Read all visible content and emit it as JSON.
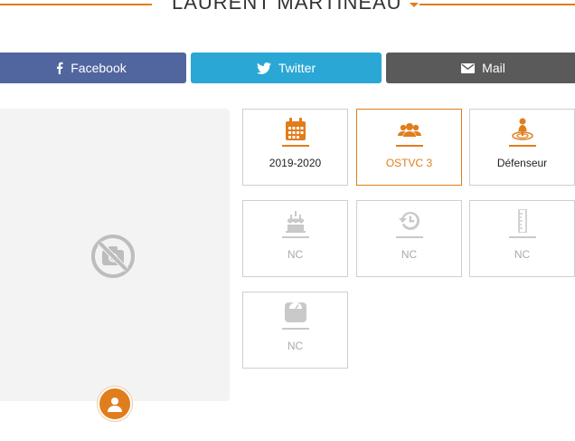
{
  "header": {
    "name": "LAURENT MARTINEAU"
  },
  "share": {
    "facebook_label": "Facebook",
    "twitter_label": "Twitter",
    "mail_label": "Mail"
  },
  "stats": {
    "season": "2019-2020",
    "team": "OSTVC 3",
    "position": "Défenseur",
    "age": "NC",
    "experience": "NC",
    "height": "NC",
    "weight": "NC"
  },
  "colors": {
    "accent": "#e07d1c",
    "facebook": "#51659f",
    "twitter": "#2aa7d4",
    "mail": "#5a5a5a",
    "muted": "#c9c9c9"
  },
  "icons": {
    "season": "calendar-icon",
    "team": "team-icon",
    "position": "position-marker-icon",
    "age": "birthday-cake-icon",
    "experience": "history-icon",
    "height": "ruler-icon",
    "weight": "scale-icon"
  }
}
